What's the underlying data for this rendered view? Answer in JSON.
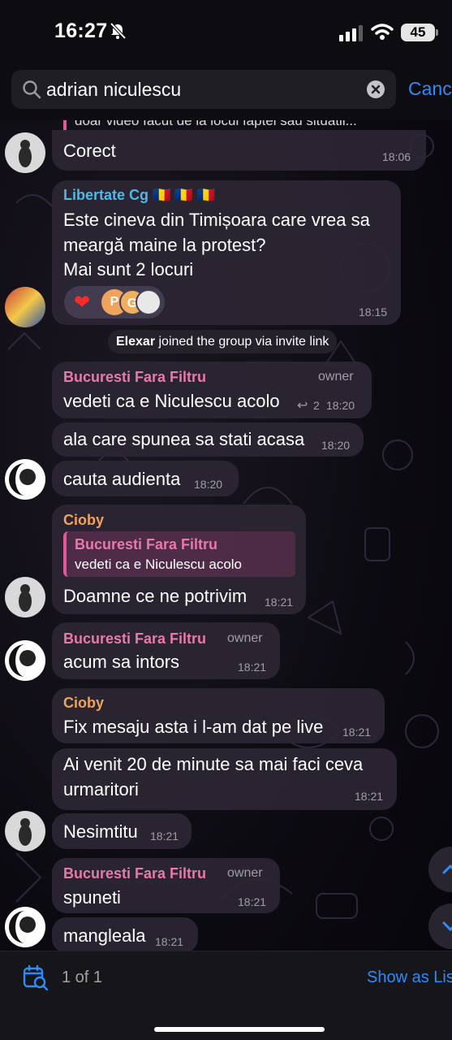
{
  "status_bar": {
    "time": "16:27",
    "battery": "45"
  },
  "search": {
    "query": "adrian niculescu",
    "cancel": "Cancel"
  },
  "top_quote": "doar video facut de la locul faptei sau situatii...",
  "messages": [
    {
      "id": "m1",
      "text": "Corect",
      "time": "18:06"
    },
    {
      "id": "m2",
      "sender": "Libertate Cg 🇷🇴 🇷🇴 🇷🇴",
      "lines": [
        "Este cineva din Timișoara care vrea sa",
        "meargă maine la protest?",
        "Mai sunt 2 locuri"
      ],
      "time": "18:15",
      "reactions": [
        "❤",
        "P",
        "G"
      ]
    },
    {
      "id": "m3",
      "sender": "Bucuresti Fara Filtru",
      "badge": "owner",
      "text": "vedeti ca e Niculescu acolo",
      "replies": "2",
      "time": "18:20"
    },
    {
      "id": "m4",
      "text": "ala care spunea sa stati acasa",
      "time": "18:20"
    },
    {
      "id": "m5",
      "text": "cauta audienta",
      "time": "18:20"
    },
    {
      "id": "m6",
      "sender": "Cioby",
      "quote_name": "Bucuresti Fara Filtru",
      "quote_text": "vedeti ca e Niculescu acolo",
      "text": "Doamne ce ne potrivim",
      "time": "18:21"
    },
    {
      "id": "m7",
      "sender": "Bucuresti Fara Filtru",
      "badge": "owner",
      "text": "acum sa intors",
      "time": "18:21"
    },
    {
      "id": "m8",
      "sender": "Cioby",
      "text": "Fix mesaju asta i l-am dat pe live",
      "time": "18:21"
    },
    {
      "id": "m9",
      "lines": [
        "Ai venit 20 de minute sa mai faci ceva",
        "urmaritori"
      ],
      "time": "18:21"
    },
    {
      "id": "m10",
      "text": "Nesimtitu",
      "time": "18:21"
    },
    {
      "id": "m11",
      "sender": "Bucuresti Fara Filtru",
      "badge": "owner",
      "text": "spuneti",
      "time": "18:21"
    },
    {
      "id": "m12",
      "text": "mangleala",
      "time": "18:21"
    }
  ],
  "service_message": {
    "user": "Elexar",
    "text": " joined the group via invite link"
  },
  "bottom_bar": {
    "count": "1 of 1",
    "show_as_list": "Show as List"
  },
  "colors": {
    "accent": "#2f8cf7",
    "libertate_name": "#4fb8e6",
    "bucuresti_name": "#e77aa8",
    "cioby_name": "#f0a35a",
    "bubble": "#2c2634"
  }
}
